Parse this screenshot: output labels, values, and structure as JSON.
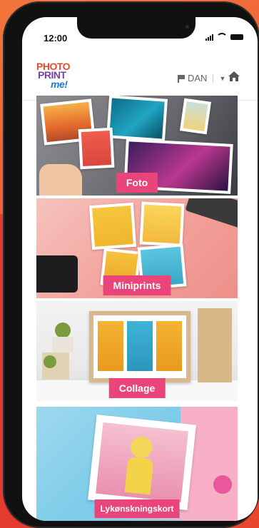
{
  "status_bar": {
    "time": "12:00"
  },
  "header": {
    "logo": {
      "line1": "PHOTO",
      "line2": "PRINT",
      "line3": "me!"
    },
    "language": "DAN"
  },
  "categories": [
    {
      "label": "Foto"
    },
    {
      "label": "Miniprints"
    },
    {
      "label": "Collage"
    },
    {
      "label": "Lykønskningskort"
    }
  ],
  "colors": {
    "accent": "#e9457a",
    "background_orange": "#ef5b34"
  }
}
